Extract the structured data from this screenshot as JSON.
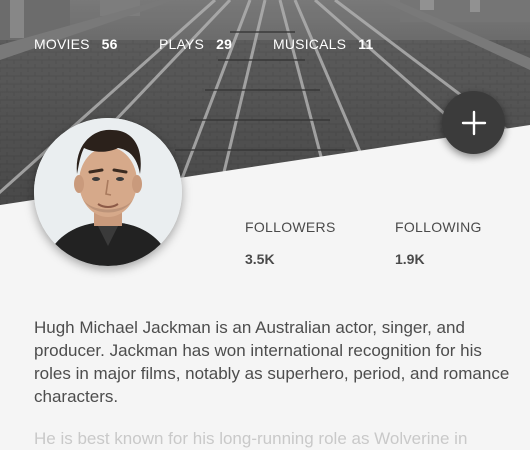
{
  "stats": {
    "movies": {
      "label": "MOVIES",
      "value": "56"
    },
    "plays": {
      "label": "PLAYS",
      "value": "29"
    },
    "musicals": {
      "label": "MUSICALS",
      "value": "11"
    }
  },
  "social": {
    "followers": {
      "label": "FOLLOWERS",
      "value": "3.5K"
    },
    "following": {
      "label": "FOLLOWING",
      "value": "1.9K"
    }
  },
  "bio": {
    "paragraph1": "Hugh Michael Jackman is an Australian actor, singer, and producer. Jackman has won international recognition for his roles in major films, notably as superhero, period, and romance characters.",
    "paragraph2": "He is best known for his long-running role as Wolverine in"
  },
  "fab": {
    "icon": "plus-icon"
  },
  "colors": {
    "fab": "#3b3b3b",
    "panel": "#f5f5f5",
    "text": "#4d4d4d"
  }
}
